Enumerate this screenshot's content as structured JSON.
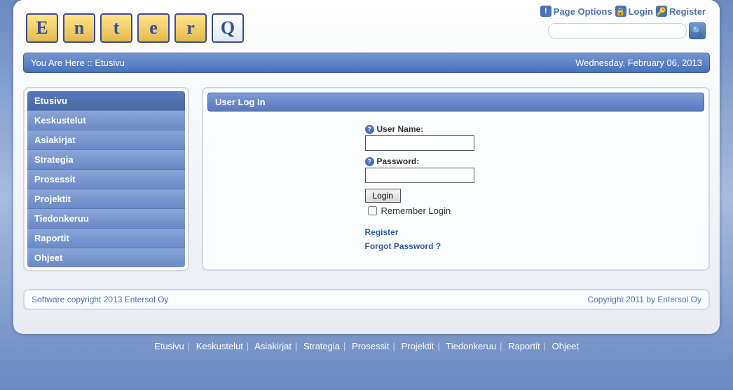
{
  "logo_letters": [
    "E",
    "n",
    "t",
    "e",
    "r",
    "Q"
  ],
  "top": {
    "page_options": "Page Options",
    "login": "Login",
    "register": "Register"
  },
  "breadcrumb": {
    "prefix": "You Are Here :: ",
    "current": "Etusivu"
  },
  "date": "Wednesday, February 06, 2013",
  "nav": [
    "Etusivu",
    "Keskustelut",
    "Asiakirjat",
    "Strategia",
    "Prosessit",
    "Projektit",
    "Tiedonkeruu",
    "Raportit",
    "Ohjeet"
  ],
  "module": {
    "title": "User Log In",
    "user_label": "User Name:",
    "pass_label": "Password:",
    "login_btn": "Login",
    "remember": "Remember Login",
    "register": "Register",
    "forgot": "Forgot Password ?"
  },
  "footer": {
    "left": "Software copyright 2013 Entersol Oy",
    "right": "Copyright 2011 by Entersol Oy"
  }
}
